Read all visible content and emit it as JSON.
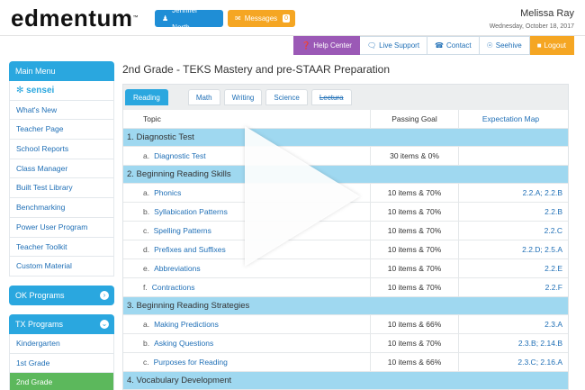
{
  "header": {
    "logo": "edmentum",
    "logo_tm": "™",
    "user_button": "Jennifer North",
    "messages_button": "Messages",
    "messages_count": "0",
    "username": "Melissa Ray",
    "date": "Wednesday, October 18, 2017"
  },
  "utility": {
    "help": "Help Center",
    "live": "Live Support",
    "contact": "Contact",
    "seehive": "Seehive",
    "logout": "Logout"
  },
  "sidebar": {
    "main_menu": "Main Menu",
    "sensei": "sensei",
    "items": [
      "What's New",
      "Teacher Page",
      "School Reports",
      "Class Manager",
      "Built Test Library",
      "Benchmarking",
      "Power User Program",
      "Teacher Toolkit",
      "Custom Material"
    ],
    "ok_programs": "OK Programs",
    "tx_programs": "TX Programs",
    "tx_items": [
      "Kindergarten",
      "1st Grade",
      "2nd Grade"
    ]
  },
  "main": {
    "title": "2nd Grade - TEKS Mastery and pre-STAAR Preparation",
    "tabs": [
      "Reading",
      "Math",
      "Writing",
      "Science",
      "Lectura"
    ],
    "columns": {
      "topic": "Topic",
      "goal": "Passing Goal",
      "map": "Expectation Map"
    },
    "sections": [
      {
        "title": "1.  Diagnostic Test",
        "rows": [
          {
            "letter": "a.",
            "topic": "Diagnostic Test",
            "goal": "30 items & 0%",
            "map": ""
          }
        ]
      },
      {
        "title": "2.  Beginning Reading Skills",
        "rows": [
          {
            "letter": "a.",
            "topic": "Phonics",
            "goal": "10 items & 70%",
            "map": "2.2.A; 2.2.B"
          },
          {
            "letter": "b.",
            "topic": "Syllabication Patterns",
            "goal": "10 items & 70%",
            "map": "2.2.B"
          },
          {
            "letter": "c.",
            "topic": "Spelling Patterns",
            "goal": "10 items & 70%",
            "map": "2.2.C"
          },
          {
            "letter": "d.",
            "topic": "Prefixes and Suffixes",
            "goal": "10 items & 70%",
            "map": "2.2.D; 2.5.A"
          },
          {
            "letter": "e.",
            "topic": "Abbreviations",
            "goal": "10 items & 70%",
            "map": "2.2.E"
          },
          {
            "letter": "f.",
            "topic": "Contractions",
            "goal": "10 items & 70%",
            "map": "2.2.F"
          }
        ]
      },
      {
        "title": "3.  Beginning Reading Strategies",
        "rows": [
          {
            "letter": "a.",
            "topic": "Making Predictions",
            "goal": "10 items & 66%",
            "map": "2.3.A"
          },
          {
            "letter": "b.",
            "topic": "Asking Questions",
            "goal": "10 items & 70%",
            "map": "2.3.B; 2.14.B"
          },
          {
            "letter": "c.",
            "topic": "Purposes for Reading",
            "goal": "10 items & 66%",
            "map": "2.3.C; 2.16.A"
          }
        ]
      },
      {
        "title": "4.  Vocabulary Development",
        "rows": []
      }
    ]
  }
}
